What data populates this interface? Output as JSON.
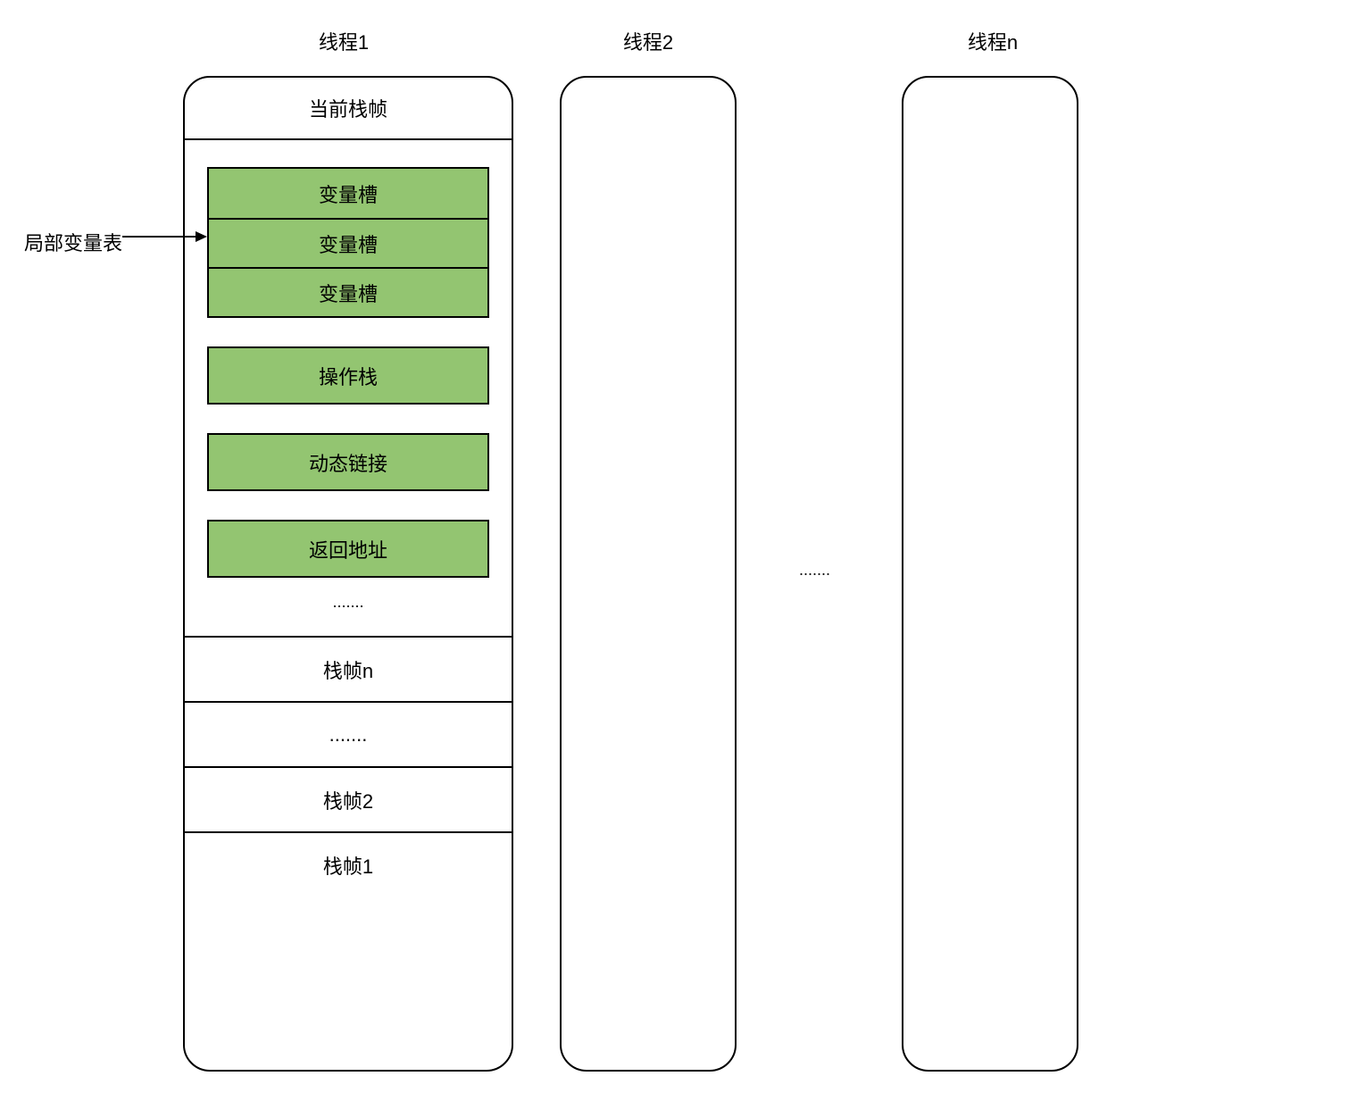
{
  "threads": {
    "t1": {
      "title": "线程1"
    },
    "t2": {
      "title": "线程2"
    },
    "tn": {
      "title": "线程n"
    }
  },
  "thread1": {
    "currentFrame": "当前栈帧",
    "slots": [
      "变量槽",
      "变量槽",
      "变量槽"
    ],
    "operandStack": "操作栈",
    "dynamicLink": "动态链接",
    "returnAddress": "返回地址",
    "ellipsis": ".......",
    "frameN": "栈帧n",
    "frameEllipsis": ".......",
    "frame2": "栈帧2",
    "frame1": "栈帧1"
  },
  "localVarLabel": "局部变量表",
  "betweenEllipsis": "......."
}
